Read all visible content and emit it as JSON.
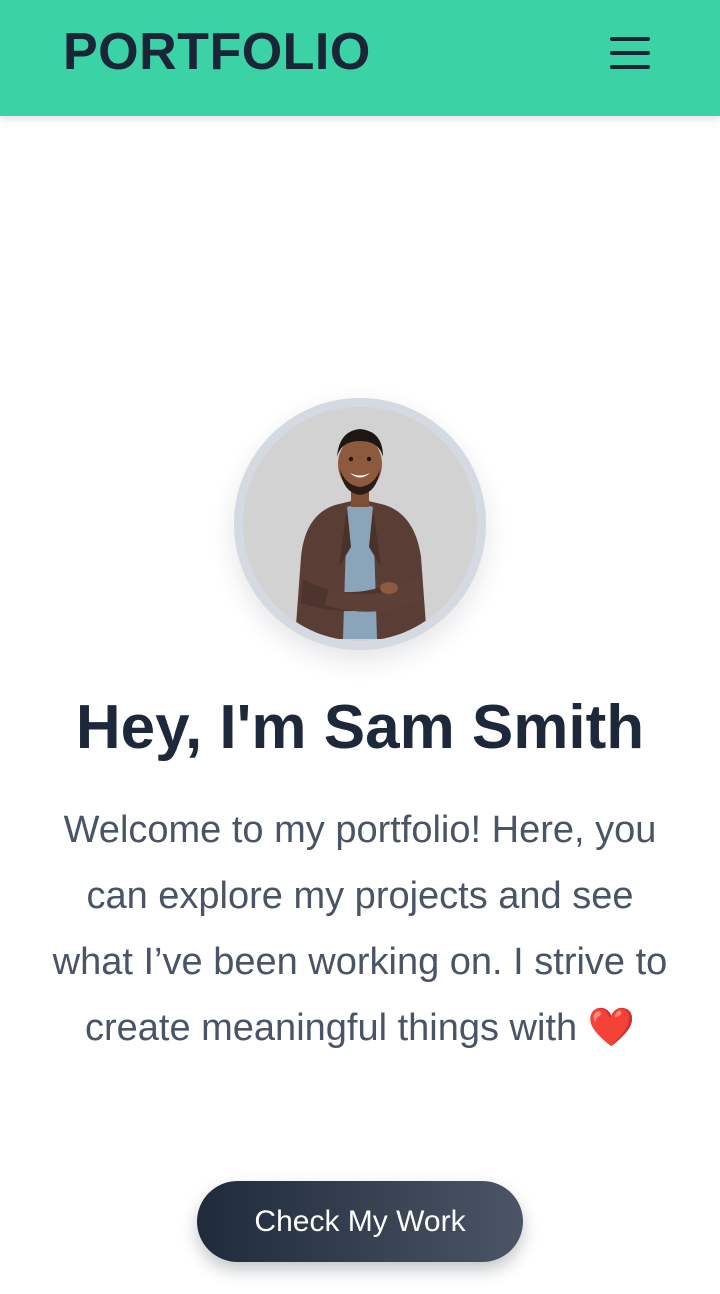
{
  "header": {
    "logo": "PORTFOLIO",
    "menu_icon": "hamburger-menu-icon",
    "background_color": "#3bd3a6"
  },
  "hero": {
    "headline": "Hey, I'm Sam Smith",
    "intro_text": "Welcome to my portfolio! Here, you can explore my projects and see what I’ve been working on. I strive to create meaningful things with",
    "intro_emoji": "❤️",
    "cta_label": "Check My Work"
  },
  "colors": {
    "heading": "#1d283b",
    "body_text": "#4a5467",
    "button_gradient_start": "#1f2a3b",
    "button_gradient_end": "#4b5566"
  }
}
